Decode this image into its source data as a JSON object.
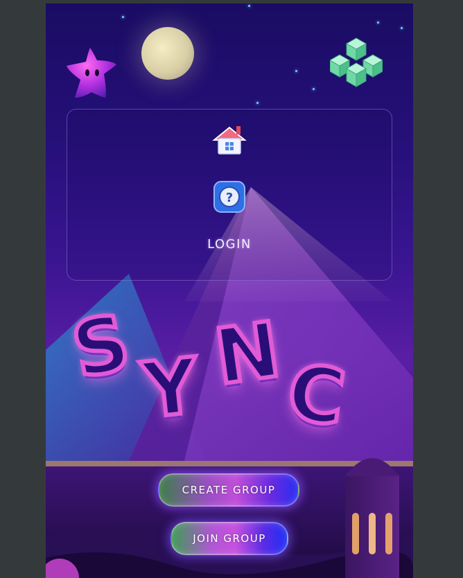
{
  "nav": {
    "home_icon": "home-icon",
    "help_icon": "help-icon",
    "login_label": "LOGIN"
  },
  "decor": {
    "mascot_icon": "star-creature-icon",
    "cube_icon": "cube-cluster-icon"
  },
  "logo": {
    "letters": [
      "S",
      "Y",
      "N",
      "C"
    ]
  },
  "actions": {
    "create_group_label": "CREATE GROUP",
    "join_group_label": "JOIN GROUP"
  },
  "colors": {
    "accent_pink": "#e25bd6",
    "accent_purple": "#6a2be0",
    "accent_blue": "#2a2cf0",
    "cube_green": "#7de0b0"
  }
}
